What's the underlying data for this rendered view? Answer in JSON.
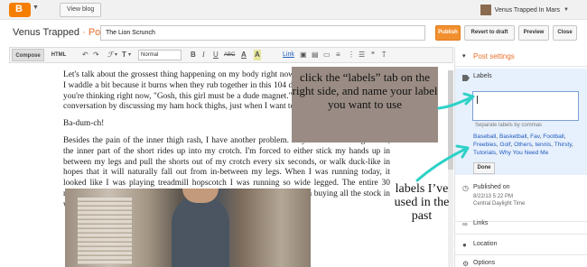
{
  "topbar": {
    "logo_letter": "B",
    "view_blog": "View blog",
    "user_name": "Venus Trapped In Mars"
  },
  "header": {
    "blog_name": "Venus Trapped",
    "separator": "·",
    "post_word": "Post",
    "post_title": "The Lion Scrunch",
    "publish": "Publish",
    "revert": "Revert to draft",
    "preview": "Preview",
    "close": "Close"
  },
  "toolbar": {
    "compose": "Compose",
    "html": "HTML",
    "font_size_icon": "T",
    "format_value": "Normal",
    "bold": "B",
    "italic": "I",
    "underline": "U",
    "strike": "ABC",
    "link": "Link"
  },
  "post_body": {
    "p1": "Let's talk about the grossest thing happening on my body right now. My thighs are so large that I waddle a bit because it burns when they rub together in this 104 degree weather. Okay, I know you're thinking right now, \"Gosh, this girl must be a dude magnet.\" Yes, I am. Let's start off this conversation by discussing my ham hock thighs, just when I want to put my best foot forward.",
    "p2": "Ba-dum-ch!",
    "p3": "Besides the pain of the inner thigh rash, I have another problem. Anytime I'm wearing shorts, the inner part of the short rides up into my crotch. I'm forced to either stick my hands up in between my legs and pull the shorts out of my crotch every six seconds, or walk duck-like in hopes that it will naturally fall out from in-between my legs. When I was running today, it looked like I was playing treadmill hopscotch I was running so wide legged. The entire 30 minutes all I could think is, \"If I ever make it off this treadmill alive, I'm buying all the stock in workout leggings\"."
  },
  "annotations": {
    "labels_tip": "click the “labels” tab on the right side, and name your label you want to use",
    "used_labels": "labels I’ve used in the past"
  },
  "sidebar": {
    "heading": "Post settings",
    "labels": {
      "title": "Labels",
      "hint": "Separate labels by commas",
      "items": [
        "Baseball",
        "Basketball",
        "Fav",
        "Football",
        "Freebies",
        "Golf",
        "Others",
        "tennis",
        "Thirsty",
        "Tutorials",
        "Why You Need Me"
      ],
      "done": "Done"
    },
    "published": {
      "title": "Published on",
      "date": "8/22/13 5:22 PM",
      "tz": "Central Daylight Time"
    },
    "links": "Links",
    "location": "Location",
    "options": "Options"
  },
  "colors": {
    "accent": "#e8702a",
    "publish": "#f2902f",
    "panel": "#e7f0fd",
    "label_link": "#1f5bbd",
    "note_box": "#9a8c84",
    "arrow": "#2ed1c7"
  }
}
